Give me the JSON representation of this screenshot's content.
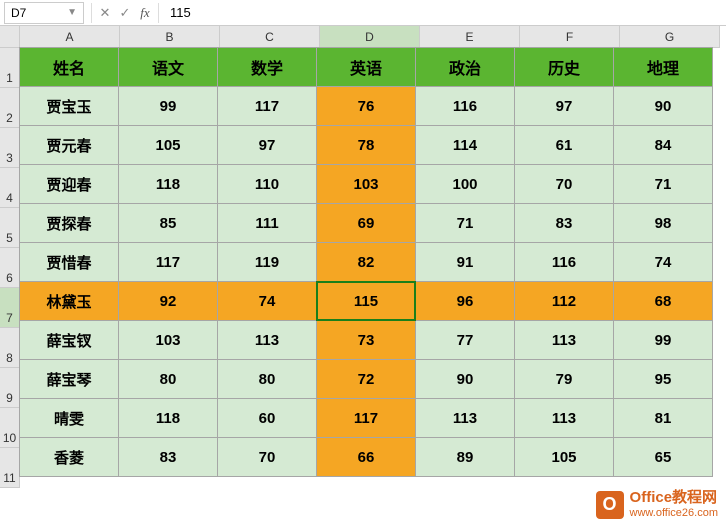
{
  "name_box": "D7",
  "formula_value": "115",
  "col_letters": [
    "A",
    "B",
    "C",
    "D",
    "E",
    "F",
    "G"
  ],
  "row_numbers": [
    "1",
    "2",
    "3",
    "4",
    "5",
    "6",
    "7",
    "8",
    "9",
    "10",
    "11"
  ],
  "active_col_index": 3,
  "active_row_index": 6,
  "headers": [
    "姓名",
    "语文",
    "数学",
    "英语",
    "政治",
    "历史",
    "地理"
  ],
  "chart_data": {
    "type": "table",
    "columns": [
      "姓名",
      "语文",
      "数学",
      "英语",
      "政治",
      "历史",
      "地理"
    ],
    "rows": [
      [
        "贾宝玉",
        99,
        117,
        76,
        116,
        97,
        90
      ],
      [
        "贾元春",
        105,
        97,
        78,
        114,
        61,
        84
      ],
      [
        "贾迎春",
        118,
        110,
        103,
        100,
        70,
        71
      ],
      [
        "贾探春",
        85,
        111,
        69,
        71,
        83,
        98
      ],
      [
        "贾惜春",
        117,
        119,
        82,
        91,
        116,
        74
      ],
      [
        "林黛玉",
        92,
        74,
        115,
        96,
        112,
        68
      ],
      [
        "薛宝钗",
        103,
        113,
        73,
        77,
        113,
        99
      ],
      [
        "薛宝琴",
        80,
        80,
        72,
        90,
        79,
        95
      ],
      [
        "晴雯",
        118,
        60,
        117,
        113,
        113,
        81
      ],
      [
        "香菱",
        83,
        70,
        66,
        89,
        105,
        65
      ]
    ]
  },
  "watermark": {
    "icon_letter": "O",
    "title": "Office教程网",
    "url": "www.office26.com"
  }
}
